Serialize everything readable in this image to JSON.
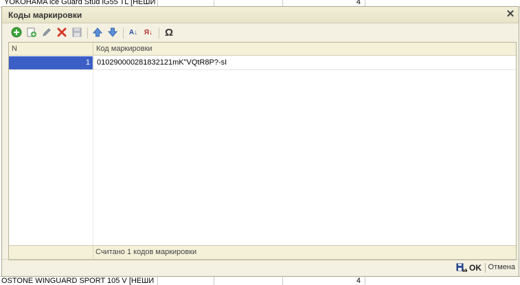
{
  "background": {
    "top_row_text": "YOKOHAMA ice Guard Stud iG55 TL [НЕШИ",
    "top_row_qty": "4",
    "bottom_row_text": "OSTONE WINGUARD SPORT 105 V [НЕШИ",
    "bottom_row_qty": "4"
  },
  "dialog": {
    "title": "Коды маркировки",
    "close_symbol": "✕"
  },
  "toolbar": {
    "items": [
      "add-icon",
      "copy-icon",
      "edit-icon",
      "delete-icon",
      "save-icon",
      "move-up-icon",
      "move-down-icon",
      "sort-asc-icon",
      "sort-desc-icon",
      "special-chars-icon"
    ],
    "sort_asc_label": "А↓",
    "sort_desc_label": "Я↓",
    "omega_label": "Ω"
  },
  "grid": {
    "columns": {
      "n": "N",
      "code": "Код маркировки"
    },
    "rows": [
      {
        "n": "1",
        "code": "010290000281832121mK\"VQtR8P?-sI"
      }
    ],
    "footer": "Считано 1 кодов маркировки"
  },
  "buttons": {
    "ok": "OK",
    "cancel": "Отмена"
  },
  "colors": {
    "selection": "#3b5fc7",
    "dialog_bg": "#f4f1e2"
  }
}
